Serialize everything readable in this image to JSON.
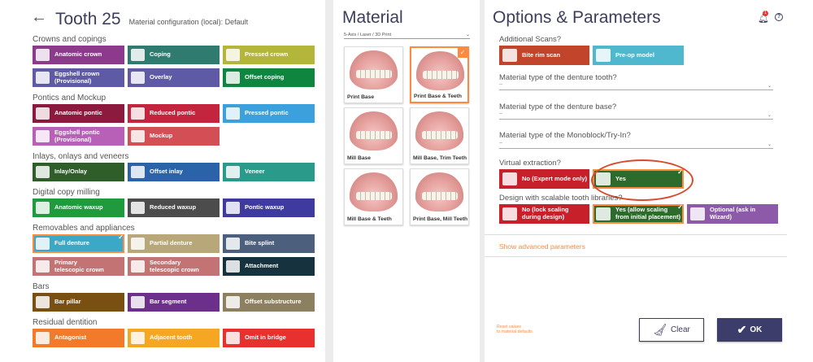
{
  "tooth": {
    "back_icon": "arrow-left-icon",
    "title": "Tooth 25",
    "material_config": "Material configuration (local):  Default"
  },
  "sections": [
    "Crowns and copings",
    "Pontics and Mockup",
    "Inlays, onlays and veneers",
    "Digital copy milling",
    "Removables and appliances",
    "Bars",
    "Residual dentition"
  ],
  "buttons": [
    {
      "label": "Anatomic crown",
      "color": "#8e3a8c"
    },
    {
      "label": "Coping",
      "color": "#2f7b70"
    },
    {
      "label": "Pressed crown",
      "color": "#b3b63b"
    },
    {
      "label": "Eggshell crown\n(Provisional)",
      "color": "#5e5aa5"
    },
    {
      "label": "Overlay",
      "color": "#5e5aa5"
    },
    {
      "label": "Offset coping",
      "color": "#0f8640"
    },
    {
      "label": "Anatomic pontic",
      "color": "#8c1a3e"
    },
    {
      "label": "Reduced pontic",
      "color": "#c3243e"
    },
    {
      "label": "Pressed pontic",
      "color": "#3ba0dc"
    },
    {
      "label": "Eggshell pontic\n(Provisional)",
      "color": "#b860b8"
    },
    {
      "label": "Mockup",
      "color": "#d44e56"
    },
    {
      "label": "Inlay/Onlay",
      "color": "#2f5e2a"
    },
    {
      "label": "Offset inlay",
      "color": "#2a63a8"
    },
    {
      "label": "Veneer",
      "color": "#2a9a8a"
    },
    {
      "label": "Anatomic waxup",
      "color": "#1f9a3c"
    },
    {
      "label": "Reduced waxup",
      "color": "#4c4c4c"
    },
    {
      "label": "Pontic waxup",
      "color": "#3f3aa0"
    },
    {
      "label": "Full denture",
      "color": "#3ba8c8"
    },
    {
      "label": "Partial denture",
      "color": "#b8a778"
    },
    {
      "label": "Bite splint",
      "color": "#4c5f7c"
    },
    {
      "label": "Primary\ntelescopic crown",
      "color": "#c37373"
    },
    {
      "label": "Secondary\ntelescopic crown",
      "color": "#c37373"
    },
    {
      "label": "Attachment",
      "color": "#15323e"
    },
    {
      "label": "Bar pillar",
      "color": "#7a4f12"
    },
    {
      "label": "Bar segment",
      "color": "#6d2f8c"
    },
    {
      "label": "Offset substructure",
      "color": "#8c8060"
    },
    {
      "label": "Antagonist",
      "color": "#f27a2a"
    },
    {
      "label": "Adjacent tooth",
      "color": "#f5a623"
    },
    {
      "label": "Omit in bridge",
      "color": "#e8312e"
    }
  ],
  "material": {
    "title": "Material",
    "selector": "5-Axis / Laser / 3D Print",
    "tiles": [
      "Print Base",
      "Print Base & Teeth",
      "Mill Base",
      "Mill Base, Trim Teeth",
      "Mill Base & Teeth",
      "Print Base, Mill Teeth"
    ]
  },
  "options": {
    "title": "Options & Parameters",
    "notification_count": "1",
    "additional_scans": "Additional Scans?",
    "scan_buttons": [
      {
        "label": "Bite rim scan",
        "color": "#c1442b"
      },
      {
        "label": "Pre-op model",
        "color": "#4fb8cf"
      }
    ],
    "q_tooth": "Material type of the denture tooth?",
    "q_base": "Material type of the denture base?",
    "q_monoblock": "Material type of the Monoblock/Try-In?",
    "dd_value": "--",
    "q_virtual": "Virtual extraction?",
    "virtual_buttons": [
      {
        "label": "No (Expert mode only)",
        "color": "#c8202a"
      },
      {
        "label": "Yes",
        "color": "#2d6b2c"
      }
    ],
    "q_scalable": "Design with scalable tooth libraries?",
    "scalable_buttons": [
      {
        "label": "No (lock scaling\nduring design)",
        "color": "#c8202a"
      },
      {
        "label": "Yes (allow scaling\nfrom initial placement)",
        "color": "#2d6b2c"
      },
      {
        "label": "Optional (ask in Wizard)",
        "color": "#8c5aa8"
      }
    ],
    "advanced": "Show advanced parameters",
    "reset": "Reset values\nto material defaults",
    "clear": "Clear",
    "ok": "OK"
  }
}
